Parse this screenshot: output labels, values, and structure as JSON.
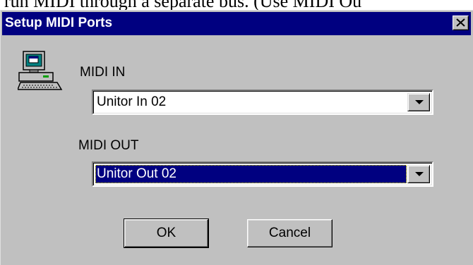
{
  "background": {
    "partial_text": "run MIDI through a separate bus. (Use MIDI Ou"
  },
  "window": {
    "title": "Setup MIDI Ports",
    "close_icon": "close-icon",
    "title_color": "#000080"
  },
  "icons": {
    "computer": "computer-icon"
  },
  "midi_in": {
    "label": "MIDI IN",
    "selected": "Unitor In 02"
  },
  "midi_out": {
    "label": "MIDI OUT",
    "selected": "Unitor Out 02"
  },
  "buttons": {
    "ok": "OK",
    "cancel": "Cancel"
  },
  "colors": {
    "face": "#c0c0c0",
    "highlight": "#000080"
  }
}
